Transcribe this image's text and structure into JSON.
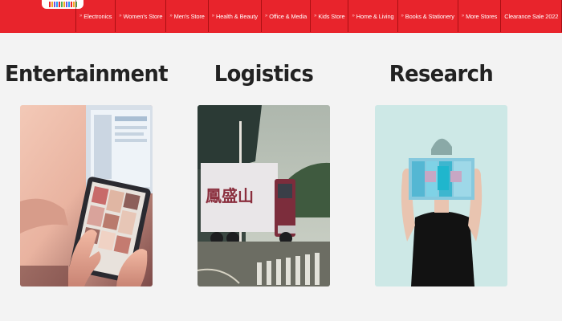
{
  "nav": {
    "items": [
      {
        "label": "Electronics"
      },
      {
        "label": "Women's Store"
      },
      {
        "label": "Men's Store"
      },
      {
        "label": "Health & Beauty"
      },
      {
        "label": "Office & Media"
      },
      {
        "label": "Kids Store"
      },
      {
        "label": "Home & Living"
      },
      {
        "label": "Books & Stationery"
      },
      {
        "label": "More Stores"
      },
      {
        "label": "Clearance Sale 2022"
      }
    ]
  },
  "cards": [
    {
      "title": "Entertainment",
      "image": "person-using-tablet-photo"
    },
    {
      "title": "Logistics",
      "image": "delivery-truck-photo"
    },
    {
      "title": "Research",
      "image": "person-holding-model-photo"
    }
  ],
  "colors": {
    "header": "#e8242c",
    "background": "#f3f3f3",
    "title": "#222222"
  }
}
